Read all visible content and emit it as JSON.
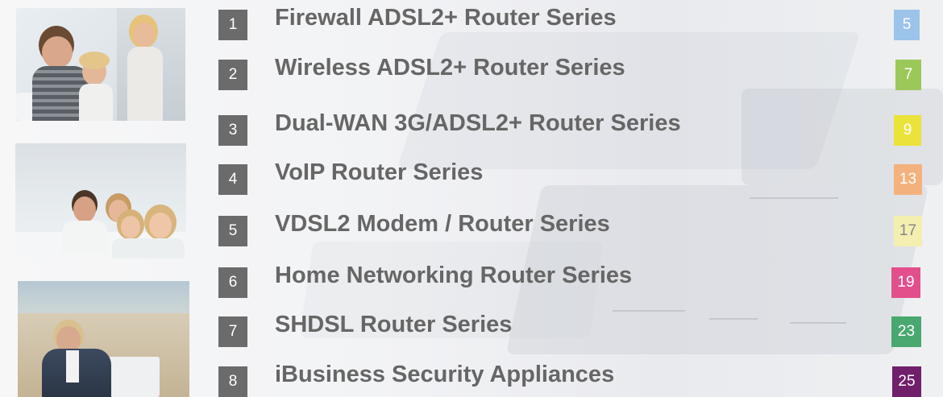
{
  "toc": {
    "items": [
      {
        "num": "1",
        "title": "Firewall ADSL2+ Router Series",
        "page": "5",
        "color": "#9cc3ea"
      },
      {
        "num": "2",
        "title": "Wireless ADSL2+ Router Series",
        "page": "7",
        "color": "#9cc85a"
      },
      {
        "num": "3",
        "title": "Dual-WAN 3G/ADSL2+ Router Series",
        "page": "9",
        "color": "#ebe23a"
      },
      {
        "num": "4",
        "title": "VoIP Router Series",
        "page": "13",
        "color": "#f3b27d"
      },
      {
        "num": "5",
        "title": "VDSL2 Modem / Router Series",
        "page": "17",
        "color": "#f3efb0"
      },
      {
        "num": "6",
        "title": "Home Networking Router Series",
        "page": "19",
        "color": "#e24f8b"
      },
      {
        "num": "7",
        "title": "SHDSL Router Series",
        "page": "23",
        "color": "#48a870"
      },
      {
        "num": "8",
        "title": "iBusiness Security Appliances",
        "page": "25",
        "color": "#70206a"
      }
    ]
  }
}
